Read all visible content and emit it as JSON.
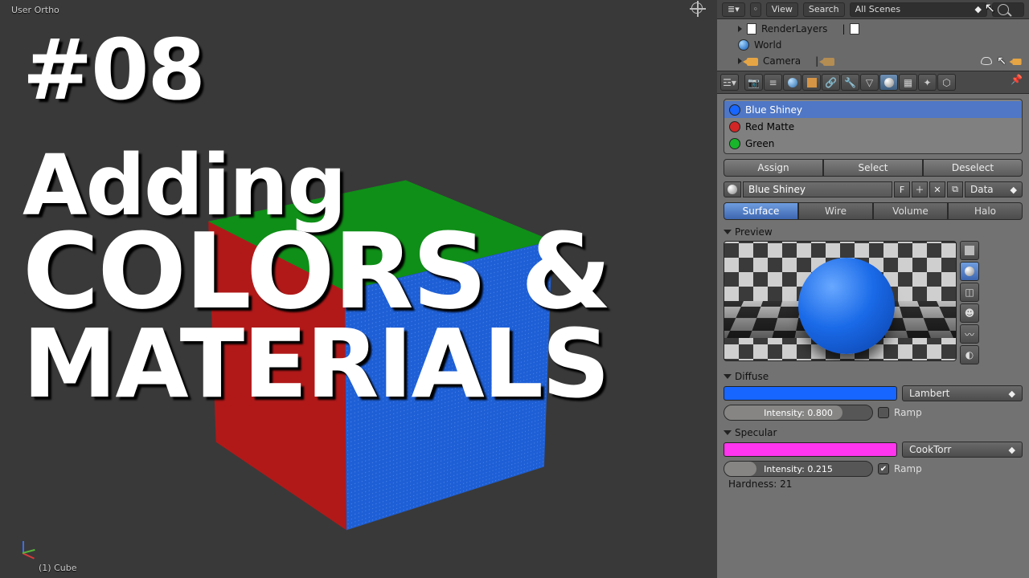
{
  "viewport": {
    "orientation_label": "User Ortho",
    "object_label": "(1) Cube"
  },
  "overlay": {
    "line1": "#08",
    "line2": "Adding",
    "line3": "COLORS &",
    "line4": "MATERIALS"
  },
  "header": {
    "view": "View",
    "search": "Search",
    "scene_selector": "All Scenes"
  },
  "outliner": {
    "render_layers": "RenderLayers",
    "world": "World",
    "camera": "Camera"
  },
  "materials": {
    "list": [
      {
        "name": "Blue Shiney",
        "color": "#1766ff",
        "selected": true
      },
      {
        "name": "Red Matte",
        "color": "#d22626",
        "selected": false
      },
      {
        "name": "Green",
        "color": "#19b52a",
        "selected": false
      }
    ],
    "assign": "Assign",
    "select": "Select",
    "deselect": "Deselect",
    "id_name": "Blue Shiney",
    "fake_user": "F",
    "link_mode": "Data"
  },
  "material_tabs": {
    "surface": "Surface",
    "wire": "Wire",
    "volume": "Volume",
    "halo": "Halo"
  },
  "sections": {
    "preview": "Preview",
    "diffuse": "Diffuse",
    "specular": "Specular"
  },
  "diffuse": {
    "color": "#1766ff",
    "shader": "Lambert",
    "intensity_label": "Intensity:",
    "intensity_value": "0.800",
    "intensity_pct": 80,
    "ramp_label": "Ramp",
    "ramp_on": false
  },
  "specular": {
    "color": "#ff35ef",
    "shader": "CookTorr",
    "intensity_label": "Intensity:",
    "intensity_value": "0.215",
    "intensity_pct": 21.5,
    "ramp_label": "Ramp",
    "ramp_on": true,
    "hardness_label": "Hardness:",
    "hardness_value": "21"
  }
}
